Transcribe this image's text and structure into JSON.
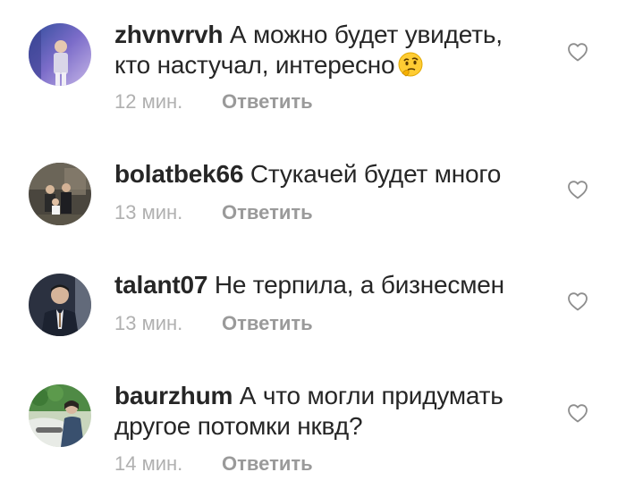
{
  "comments": [
    {
      "username": "zhvnvrvh",
      "text": "А можно будет увидеть, кто настучал, интересно",
      "emoji": "thinking-face",
      "time": "12 мин.",
      "reply": "Ответить",
      "avatar_colors": [
        "#3a5aa8",
        "#8a7bd0"
      ]
    },
    {
      "username": "bolatbek66",
      "text": "Стукачей будет много",
      "time": "13 мин.",
      "reply": "Ответить",
      "avatar_colors": [
        "#3d3a34",
        "#6b6355"
      ]
    },
    {
      "username": "talant07",
      "text": "Не терпила, а бизнесмен",
      "time": "13 мин.",
      "reply": "Ответить",
      "avatar_colors": [
        "#1f2633",
        "#4a5366"
      ]
    },
    {
      "username": "baurzhum",
      "text": "А что могли придумать другое потомки нквд?",
      "time": "14 мин.",
      "reply": "Ответить",
      "avatar_colors": [
        "#3f7a3a",
        "#b8c9a8"
      ]
    }
  ],
  "icons": {
    "like": "heart-outline-icon"
  }
}
